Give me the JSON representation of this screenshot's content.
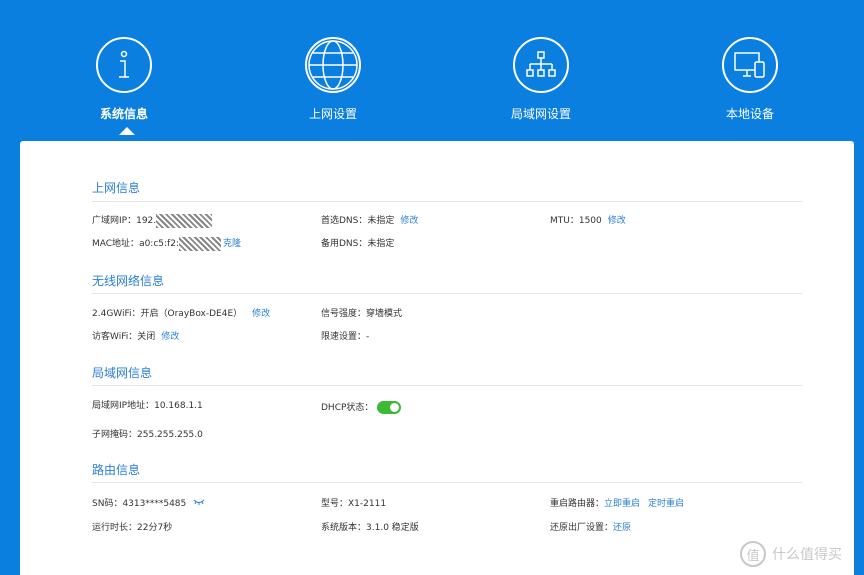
{
  "nav": {
    "items": [
      {
        "label": "系统信息",
        "icon": "info-icon"
      },
      {
        "label": "上网设置",
        "icon": "globe-icon"
      },
      {
        "label": "局域网设置",
        "icon": "network-icon"
      },
      {
        "label": "本地设备",
        "icon": "devices-icon"
      }
    ],
    "active": 0
  },
  "internet": {
    "title": "上网信息",
    "wan_ip_label": "广域网IP：",
    "wan_ip_value": "192.",
    "mac_label": "MAC地址：",
    "mac_value": "a0:c5:f2:",
    "clone_label": "克隆",
    "dns1_label": "首选DNS：",
    "dns1_value": "未指定",
    "dns1_edit": "修改",
    "dns2_label": "备用DNS：",
    "dns2_value": "未指定",
    "mtu_label": "MTU：",
    "mtu_value": "1500",
    "mtu_edit": "修改"
  },
  "wireless": {
    "title": "无线网络信息",
    "wifi24_label": "2.4GWiFi：",
    "wifi24_value": "开启（OrayBox-DE4E）",
    "wifi24_edit": "修改",
    "guest_label": "访客WiFi：",
    "guest_value": "关闭",
    "guest_edit": "修改",
    "signal_label": "信号强度：",
    "signal_value": "穿墙模式",
    "speed_label": "限速设置：",
    "speed_value": "-"
  },
  "lan": {
    "title": "局域网信息",
    "ip_label": "局域网IP地址：",
    "ip_value": "10.168.1.1",
    "mask_label": "子网掩码：",
    "mask_value": "255.255.255.0",
    "dhcp_label": "DHCP状态：",
    "dhcp_on": true
  },
  "router": {
    "title": "路由信息",
    "sn_label": "SN码：",
    "sn_value": "4313****5485",
    "model_label": "型号：",
    "model_value": "X1-2111",
    "reboot_label": "重启路由器：",
    "reboot_now": "立即重启",
    "reboot_timer": "定时重启",
    "uptime_label": "运行时长：",
    "uptime_value": "22分7秒",
    "version_label": "系统版本：",
    "version_value": "3.1.0 稳定版",
    "reset_label": "还原出厂设置：",
    "reset_action": "还原"
  },
  "watermark": {
    "logo": "值",
    "text": "什么值得买"
  },
  "colors": {
    "background": "#0a7fe0",
    "accent": "#2a7fd4",
    "toggle_on": "#3db935"
  }
}
